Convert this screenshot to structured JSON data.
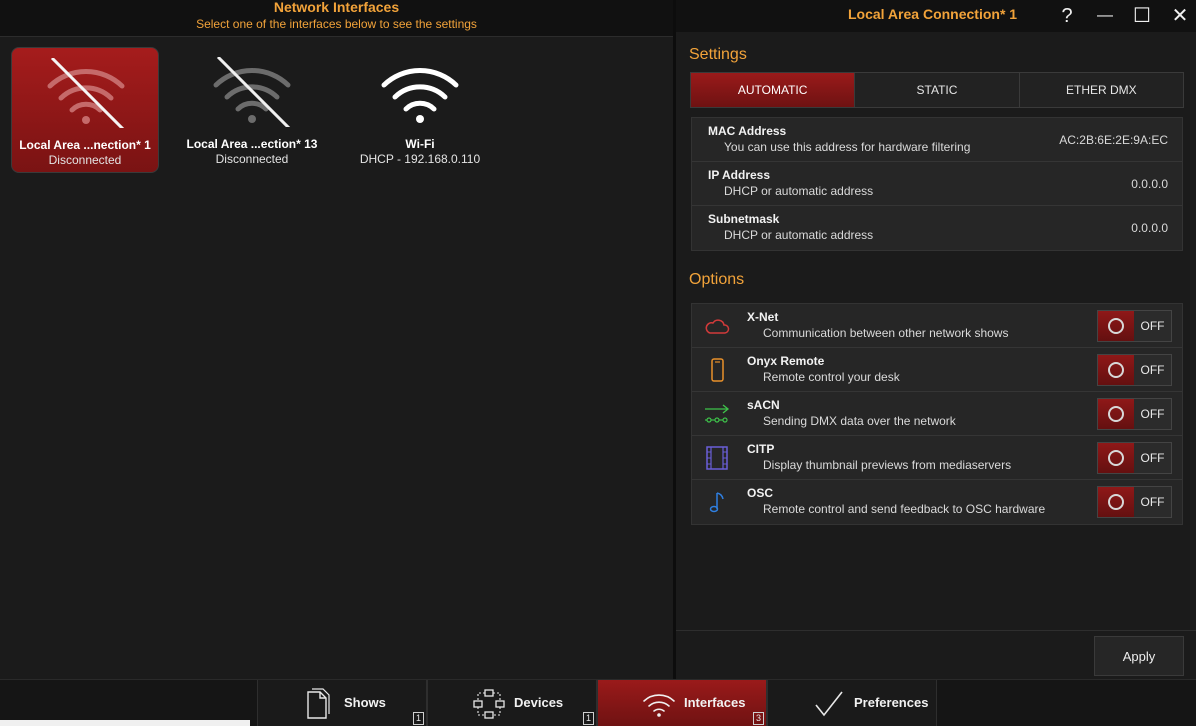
{
  "left": {
    "title": "Network Interfaces",
    "subtitle": "Select one of the interfaces below to see the settings",
    "interfaces": [
      {
        "name": "Local  Area ...nection* 1",
        "status": "Disconnected",
        "selected": true,
        "connected": false
      },
      {
        "name": "Local  Area ...ection* 13",
        "status": "Disconnected",
        "selected": false,
        "connected": false
      },
      {
        "name": "Wi-Fi",
        "status": "DHCP - 192.168.0.110",
        "selected": false,
        "connected": true
      }
    ]
  },
  "right": {
    "title": "Local Area Connection* 1",
    "window": {
      "help": "?",
      "minimize": "—",
      "maximize": "☐",
      "close": "✕"
    },
    "settings_title": "Settings",
    "tabs": [
      {
        "label": "AUTOMATIC",
        "active": true
      },
      {
        "label": "STATIC",
        "active": false
      },
      {
        "label": "ETHER DMX",
        "active": false
      }
    ],
    "settings": [
      {
        "label": "MAC Address",
        "desc": "You can use this address for hardware filtering",
        "value": "AC:2B:6E:2E:9A:EC"
      },
      {
        "label": "IP Address",
        "desc": "DHCP or automatic address",
        "value": "0.0.0.0"
      },
      {
        "label": "Subnetmask",
        "desc": "DHCP or automatic address",
        "value": "0.0.0.0"
      }
    ],
    "options_title": "Options",
    "options": [
      {
        "label": "X-Net",
        "desc": "Communication between other network shows",
        "state": "OFF",
        "icon": "cloud-icon",
        "color": "#d23a3a"
      },
      {
        "label": "Onyx Remote",
        "desc": "Remote control your desk",
        "state": "OFF",
        "icon": "phone-icon",
        "color": "#e8902a"
      },
      {
        "label": "sACN",
        "desc": "Sending DMX data over the network",
        "state": "OFF",
        "icon": "network-arrow-icon",
        "color": "#3ec24a"
      },
      {
        "label": "CITP",
        "desc": "Display thumbnail previews from mediaservers",
        "state": "OFF",
        "icon": "film-icon",
        "color": "#6a5fd8"
      },
      {
        "label": "OSC",
        "desc": "Remote control and send feedback to OSC hardware",
        "state": "OFF",
        "icon": "music-note-icon",
        "color": "#2f7fe0"
      }
    ],
    "apply": "Apply"
  },
  "nav": [
    {
      "label": "Shows",
      "badge": "1",
      "icon": "document-icon",
      "active": false
    },
    {
      "label": "Devices",
      "badge": "1",
      "icon": "devices-icon",
      "active": false
    },
    {
      "label": "Interfaces",
      "badge": "3",
      "icon": "wifi-icon",
      "active": true
    },
    {
      "label": "Preferences",
      "badge": "",
      "icon": "checkmark-icon",
      "active": false
    }
  ],
  "colors": {
    "accent": "#f2a33a",
    "active_red": "#9a1a1a"
  }
}
